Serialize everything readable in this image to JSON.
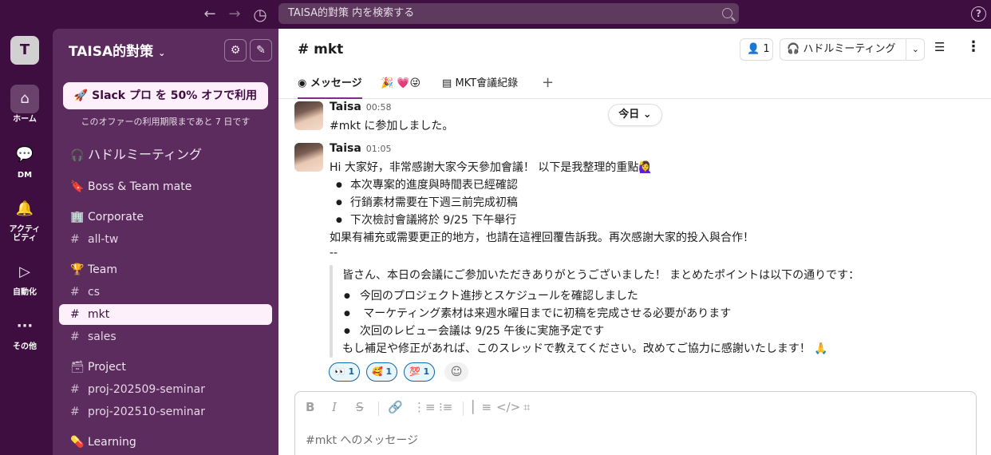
{
  "topbar": {
    "back": "←",
    "forward": "→",
    "history": "◷",
    "search_placeholder": "TAISA的對策 内を検索する",
    "help": "?"
  },
  "rail": {
    "workspace_initial": "T",
    "items": [
      {
        "label": "ホーム",
        "icon": "⌂"
      },
      {
        "label": "DM",
        "icon": "💬"
      },
      {
        "label": "アクティビティ",
        "icon": "🔔"
      },
      {
        "label": "自動化",
        "icon": "▷"
      },
      {
        "label": "その他",
        "icon": "···"
      }
    ]
  },
  "sidebar": {
    "workspace_name": "TAISA的對策",
    "workspace_chevron": "⌄",
    "settings_icon": "⚙",
    "compose_icon": "✎",
    "promo_button": "🚀 Slack プロ を 50% オフで利用",
    "promo_note": "このオファーの利用期限まであと 7 日です",
    "items": [
      {
        "glyph": "🎧",
        "label": "ハドルミーティング"
      },
      {
        "glyph": "🔖",
        "label": "Boss & Team mate"
      },
      {
        "glyph": "🏢",
        "label": "Corporate"
      },
      {
        "glyph": "#",
        "label": "all-tw"
      },
      {
        "glyph": "🏆",
        "label": "Team"
      },
      {
        "glyph": "#",
        "label": "cs"
      },
      {
        "glyph": "#",
        "label": "mkt"
      },
      {
        "glyph": "#",
        "label": "sales"
      },
      {
        "glyph": "🗃",
        "label": "Project"
      },
      {
        "glyph": "#",
        "label": "proj-202509-seminar"
      },
      {
        "glyph": "#",
        "label": "proj-202510-seminar"
      },
      {
        "glyph": "💊",
        "label": "Learning"
      }
    ]
  },
  "channel": {
    "title": "# mkt",
    "member_count": "1",
    "huddle_button": "ハドルミーティング",
    "tabs": [
      {
        "label": "メッセージ"
      },
      {
        "label": "🎉 💗😜"
      },
      {
        "label": "MKT會議紀錄"
      }
    ],
    "tab_add": "+"
  },
  "date_pill": "今日 ⌄",
  "messages": [
    {
      "author": "Taisa",
      "time": "00:58",
      "text": "#mkt に参加しました。"
    },
    {
      "author": "Taisa",
      "time": "01:05",
      "intro": "Hi 大家好，非常感謝大家今天參加會議！ 以下是我整理的重點🙋‍♀️",
      "bullets": [
        "本次專案的進度與時間表已經確認",
        "行銷素材需要在下週三前完成初稿",
        "下次檢討會議將於 9/25 下午舉行"
      ],
      "outro": "如果有補充或需要更正的地方，也請在這裡回覆告訴我。再次感謝大家的投入與合作！",
      "separator": "--",
      "quote_intro": "皆さん、本日の会議にご参加いただきありがとうございました！ まとめたポイントは以下の通りです：",
      "quote_bullets": [
        "今回のプロジェクト進捗とスケジュールを確認しました",
        " マーケティング素材は来週水曜日までに初稿を完成させる必要があります",
        "次回のレビュー会議は 9/25 午後に実施予定です"
      ],
      "quote_outro": "もし補足や修正があれば、このスレッドで教えてください。改めてご協力に感謝いたします！ 🙏",
      "reactions": [
        {
          "emoji": "👀",
          "count": "1"
        },
        {
          "emoji": "🥰",
          "count": "1"
        },
        {
          "emoji": "💯",
          "count": "1"
        }
      ]
    }
  ],
  "composer": {
    "placeholder": "#mkt へのメッセージ"
  },
  "colors": {
    "aubergine": "#3f0e40",
    "sidebar": "#5b2c5d",
    "active_item": "#fdf0fb",
    "link_blue": "#1264a3"
  }
}
